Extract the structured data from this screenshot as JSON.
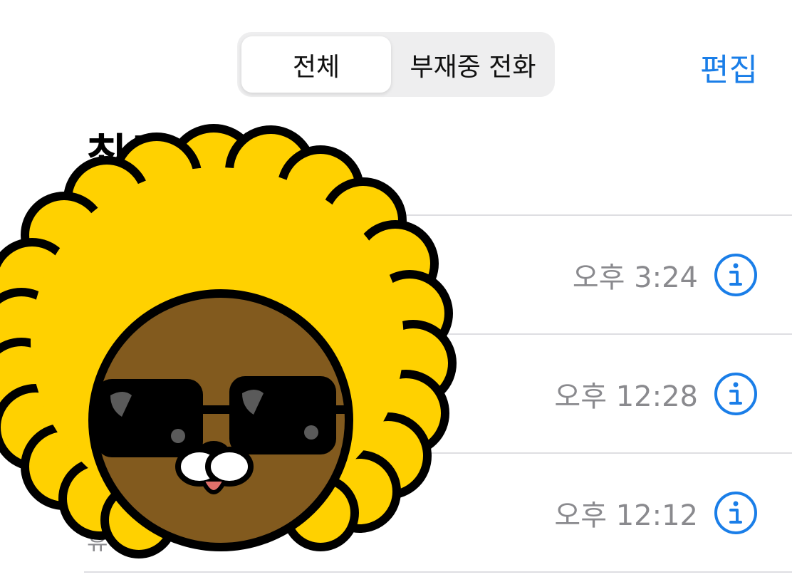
{
  "segmented": {
    "all": "전체",
    "missed": "부재중 전화"
  },
  "edit": "편집",
  "title": "최근 통화",
  "calls": [
    {
      "time": "오후 3:24",
      "sub": ""
    },
    {
      "time": "오후 12:28",
      "sub": ""
    },
    {
      "time": "오후 12:12",
      "sub": "휴대"
    }
  ],
  "colors": {
    "accent": "#1a7ee8",
    "muted": "#8a8a8e",
    "sticker_hair": "#FFD100",
    "sticker_face": "#825A1E"
  }
}
